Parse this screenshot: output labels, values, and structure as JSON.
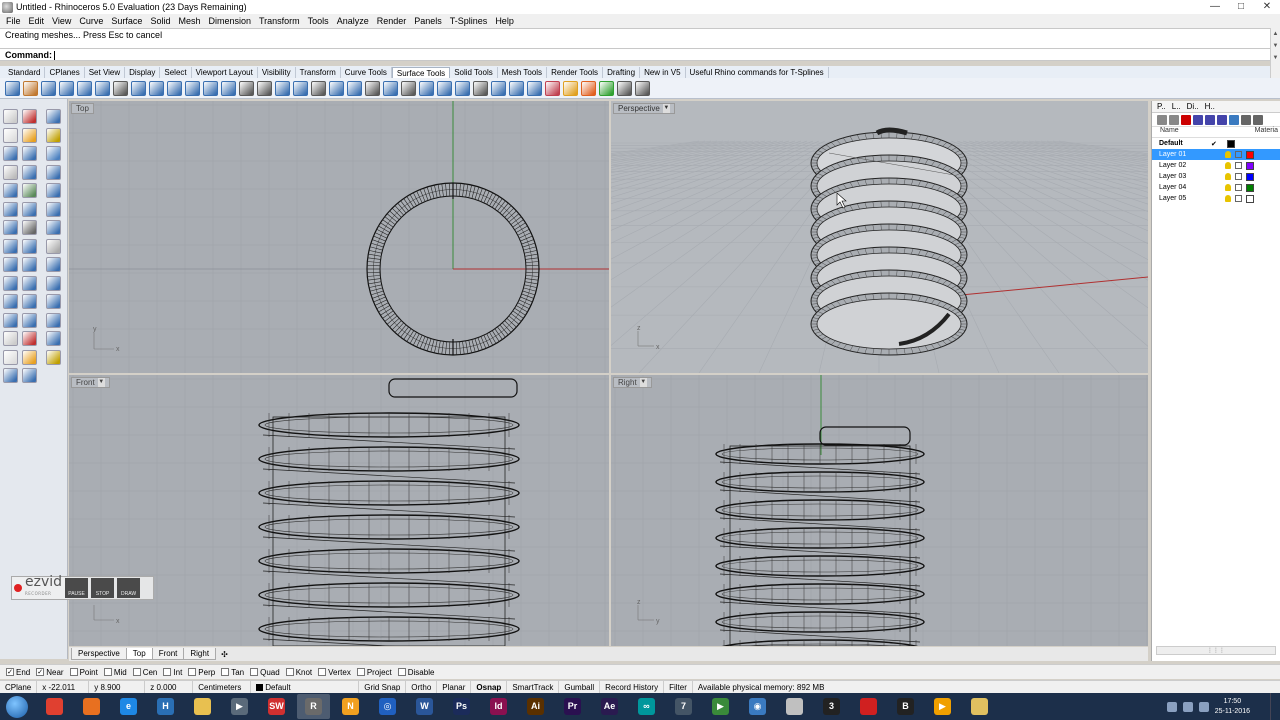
{
  "window": {
    "title": "Untitled - Rhinoceros 5.0 Evaluation (23 Days Remaining)"
  },
  "menu": [
    "File",
    "Edit",
    "View",
    "Curve",
    "Surface",
    "Solid",
    "Mesh",
    "Dimension",
    "Transform",
    "Tools",
    "Analyze",
    "Render",
    "Panels",
    "T-Splines",
    "Help"
  ],
  "command": {
    "history": "Creating meshes... Press Esc to cancel",
    "prompt": "Command:"
  },
  "toolbar_tabs": {
    "items": [
      "Standard",
      "CPlanes",
      "Set View",
      "Display",
      "Select",
      "Viewport Layout",
      "Visibility",
      "Transform",
      "Curve Tools",
      "Surface Tools",
      "Solid Tools",
      "Mesh Tools",
      "Render Tools",
      "Drafting",
      "New in V5",
      "Useful Rhino commands for T-Splines"
    ],
    "active_index": 9
  },
  "viewports": {
    "top": {
      "label": "Top"
    },
    "perspective": {
      "label": "Perspective"
    },
    "front": {
      "label": "Front"
    },
    "right": {
      "label": "Right"
    }
  },
  "viewport_tabs": {
    "items": [
      "Perspective",
      "Top",
      "Front",
      "Right"
    ],
    "active": "Top",
    "add_glyph": "✣"
  },
  "layers_panel": {
    "tabs": [
      "P..",
      "L..",
      "Di..",
      "H.."
    ],
    "columns": {
      "name": "Name",
      "material": "Materia"
    },
    "layers": [
      {
        "name": "Default",
        "current": true,
        "color": "#000000",
        "bold": true
      },
      {
        "name": "Layer 01",
        "selected": true,
        "color": "#ff0000"
      },
      {
        "name": "Layer 02",
        "color": "#8000ff"
      },
      {
        "name": "Layer 03",
        "color": "#0000ff"
      },
      {
        "name": "Layer 04",
        "color": "#008000"
      },
      {
        "name": "Layer 05",
        "color": "#ffffff"
      }
    ]
  },
  "ezvid": {
    "logo": "ezvid",
    "sub": "RECORDER",
    "buttons": [
      "PAUSE",
      "STOP",
      "DRAW"
    ]
  },
  "osnap": [
    {
      "label": "End",
      "checked": true
    },
    {
      "label": "Near",
      "checked": true
    },
    {
      "label": "Point",
      "checked": false
    },
    {
      "label": "Mid",
      "checked": false
    },
    {
      "label": "Cen",
      "checked": false
    },
    {
      "label": "Int",
      "checked": false
    },
    {
      "label": "Perp",
      "checked": false
    },
    {
      "label": "Tan",
      "checked": false
    },
    {
      "label": "Quad",
      "checked": false
    },
    {
      "label": "Knot",
      "checked": false
    },
    {
      "label": "Vertex",
      "checked": false
    },
    {
      "label": "Project",
      "checked": false
    },
    {
      "label": "Disable",
      "checked": false
    }
  ],
  "statusbar": {
    "cplane": "CPlane",
    "x": "x -22.011",
    "y": "y 8.900",
    "z": "z 0.000",
    "units": "Centimeters",
    "layer": "Default",
    "toggles": [
      "Grid Snap",
      "Ortho",
      "Planar",
      "Osnap",
      "SmartTrack",
      "Gumball",
      "Record History",
      "Filter"
    ],
    "active_toggle": "Osnap",
    "memory": "Available physical memory: 892 MB"
  },
  "taskbar": {
    "apps": [
      {
        "name": "chrome",
        "color": "#e04030",
        "glyph": ""
      },
      {
        "name": "firefox",
        "color": "#e87020",
        "glyph": ""
      },
      {
        "name": "internet-explorer",
        "color": "#1e88e5",
        "glyph": "e"
      },
      {
        "name": "app-h",
        "color": "#2a6fb4",
        "glyph": "H"
      },
      {
        "name": "explorer",
        "color": "#e8c050",
        "glyph": ""
      },
      {
        "name": "media",
        "color": "#5a6a7a",
        "glyph": "▶"
      },
      {
        "name": "solidworks",
        "color": "#d03030",
        "glyph": "SW"
      },
      {
        "name": "rhino",
        "color": "#6a6a6a",
        "glyph": "R",
        "active": true
      },
      {
        "name": "app-n",
        "color": "#f0a020",
        "glyph": "N"
      },
      {
        "name": "app-blue",
        "color": "#2060c0",
        "glyph": "◎"
      },
      {
        "name": "word",
        "color": "#2a5699",
        "glyph": "W"
      },
      {
        "name": "photoshop",
        "color": "#1b2b5a",
        "glyph": "Ps"
      },
      {
        "name": "indesign",
        "color": "#8a1050",
        "glyph": "Id"
      },
      {
        "name": "illustrator",
        "color": "#5a3000",
        "glyph": "Ai"
      },
      {
        "name": "premiere",
        "color": "#2a1050",
        "glyph": "Pr"
      },
      {
        "name": "after-effects",
        "color": "#2a1a50",
        "glyph": "Ae"
      },
      {
        "name": "arduino",
        "color": "#00979c",
        "glyph": "∞"
      },
      {
        "name": "app-7",
        "color": "#445566",
        "glyph": "7"
      },
      {
        "name": "app-play",
        "color": "#3a8a3a",
        "glyph": "▶"
      },
      {
        "name": "app-globe",
        "color": "#3a7ac0",
        "glyph": "◉"
      },
      {
        "name": "app-box",
        "color": "#c0c0c0",
        "glyph": ""
      },
      {
        "name": "app-3",
        "color": "#222222",
        "glyph": "3"
      },
      {
        "name": "app-red",
        "color": "#d02020",
        "glyph": ""
      },
      {
        "name": "app-b",
        "color": "#222222",
        "glyph": "B"
      },
      {
        "name": "app-orange",
        "color": "#f0a000",
        "glyph": "▶"
      },
      {
        "name": "app-folder",
        "color": "#e0c060",
        "glyph": ""
      }
    ],
    "time": "17:50",
    "date": "25-11-2016"
  }
}
